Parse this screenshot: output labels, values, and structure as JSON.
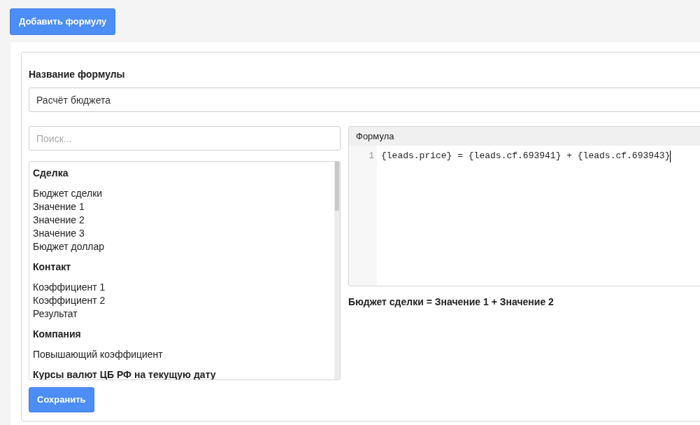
{
  "add_button": "Добавить формулу",
  "form": {
    "name_label": "Название формулы",
    "name_value": "Расчёт бюджета",
    "search": {
      "placeholder": "Поиск..."
    },
    "field_groups": [
      {
        "title": "Сделка",
        "items": [
          "Бюджет сделки",
          "Значение 1",
          "Значение 2",
          "Значение 3",
          "Бюджет доллар"
        ]
      },
      {
        "title": "Контакт",
        "items": [
          "Коэффициент 1",
          "Коэффициент 2",
          "Результат"
        ]
      },
      {
        "title": "Компания",
        "items": [
          "Повышающий коэффициент"
        ]
      },
      {
        "title": "Курсы валют ЦБ РФ на текущую дату"
      }
    ],
    "editor": {
      "title": "Формула",
      "lines": [
        {
          "number": "1",
          "code": "{leads.price} = {leads.cf.693941} + {leads.cf.693943}"
        }
      ]
    },
    "preview": "Бюджет сделки = Значение 1 + Значение 2",
    "save_button": "Сохранить"
  }
}
